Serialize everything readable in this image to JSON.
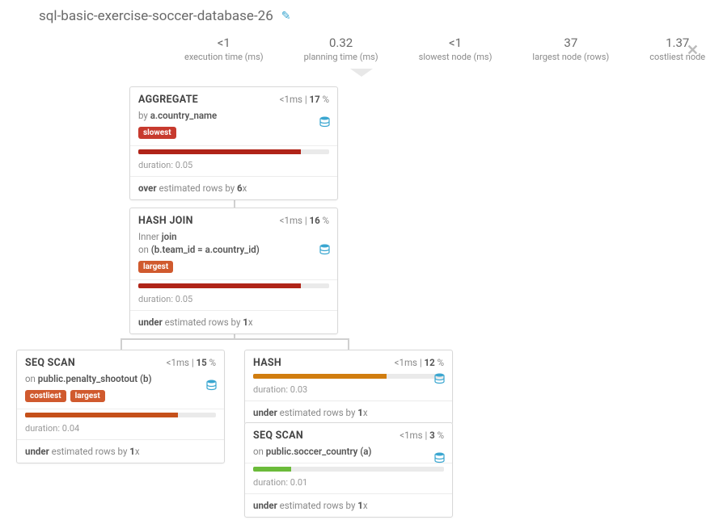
{
  "header": {
    "title": "sql-basic-exercise-soccer-database-26"
  },
  "stats": {
    "exec_time": {
      "value": "<1",
      "label": "execution time (ms)"
    },
    "plan_time": {
      "value": "0.32",
      "label": "planning time (ms)"
    },
    "slowest": {
      "value": "<1",
      "label": "slowest node (ms)"
    },
    "largest": {
      "value": "37",
      "label": "largest node (rows)"
    },
    "costliest": {
      "value": "1.37",
      "label": "costliest node"
    }
  },
  "nodes": {
    "aggregate": {
      "title": "AGGREGATE",
      "time": "<1ms",
      "percent": "17",
      "sub_prefix": "by ",
      "sub_bold": "a.country_name",
      "duration": "duration: 0.05",
      "estimate_prefix": "over",
      "estimate_mid": " estimated rows by ",
      "estimate_num": "6",
      "estimate_suffix": "x"
    },
    "hashjoin": {
      "title": "HASH JOIN",
      "time": "<1ms",
      "percent": "16",
      "sub_line1a": "Inner ",
      "sub_line1b": "join",
      "sub_line2a": "on ",
      "sub_line2b": "(b.team_id = a.country_id)",
      "duration": "duration: 0.05",
      "estimate_prefix": "under",
      "estimate_mid": " estimated rows by ",
      "estimate_num": "1",
      "estimate_suffix": "x"
    },
    "seqscan_b": {
      "title": "SEQ SCAN",
      "time": "<1ms",
      "percent": "15",
      "sub_prefix": "on ",
      "sub_bold": "public.penalty_shootout (b)",
      "duration": "duration: 0.04",
      "estimate_prefix": "under",
      "estimate_mid": " estimated rows by ",
      "estimate_num": "1",
      "estimate_suffix": "x"
    },
    "hash": {
      "title": "HASH",
      "time": "<1ms",
      "percent": "12",
      "duration": "duration: 0.03",
      "estimate_prefix": "under",
      "estimate_mid": " estimated rows by ",
      "estimate_num": "1",
      "estimate_suffix": "x"
    },
    "seqscan_a": {
      "title": "SEQ SCAN",
      "time": "<1ms",
      "percent": "3",
      "sub_prefix": "on ",
      "sub_bold": "public.soccer_country (a)",
      "duration": "duration: 0.01",
      "estimate_prefix": "under",
      "estimate_mid": " estimated rows by ",
      "estimate_num": "1",
      "estimate_suffix": "x"
    }
  },
  "badges": {
    "slowest": "slowest",
    "largest": "largest",
    "costliest": "costliest"
  }
}
